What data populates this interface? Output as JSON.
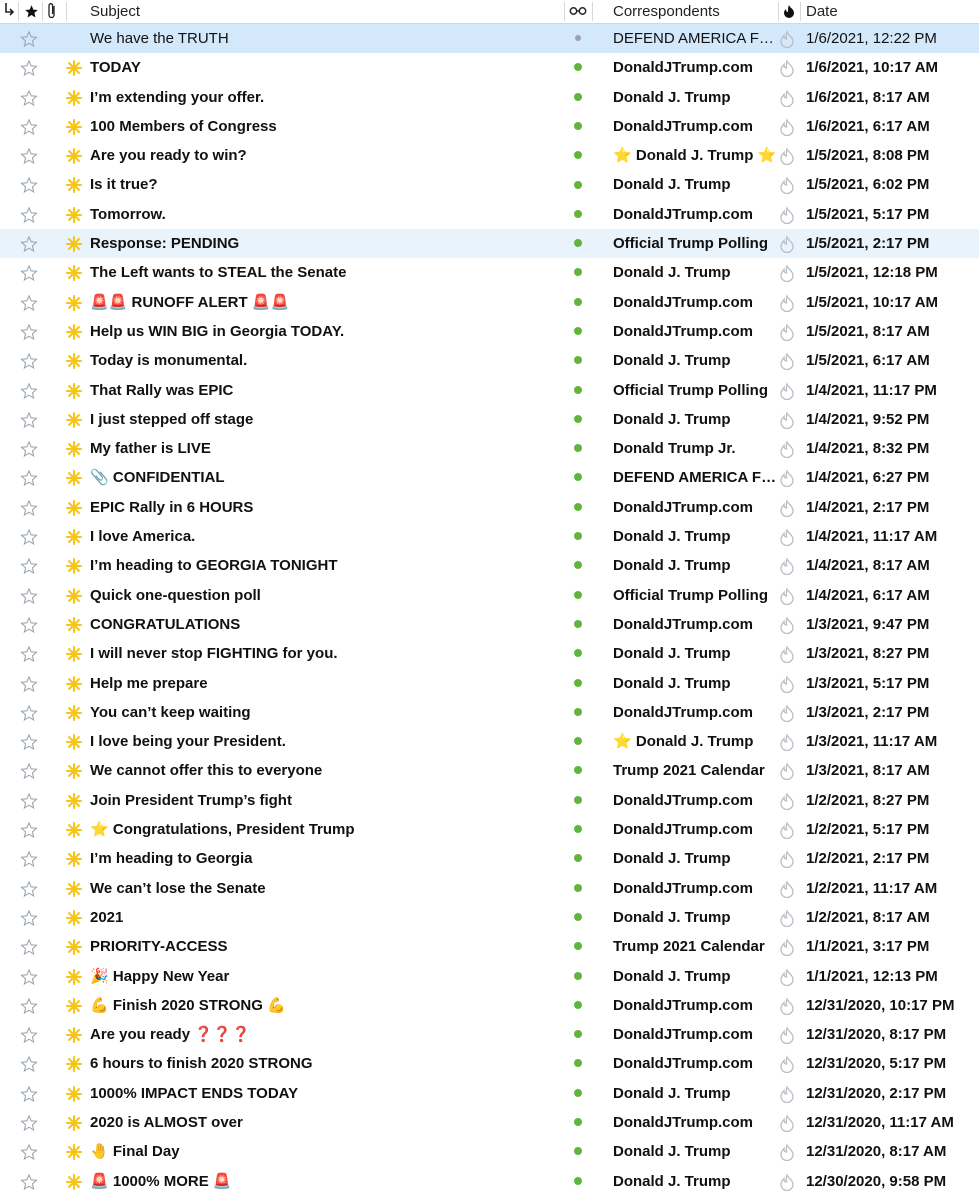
{
  "columns": {
    "thread_icon": "thread-icon",
    "star_icon": "star-icon",
    "attachment_icon": "paperclip-icon",
    "subject": "Subject",
    "read_status_icon": "glasses-icon",
    "correspondents": "Correspondents",
    "junk_icon": "flame-icon",
    "date": "Date"
  },
  "colors": {
    "selected_row": "#d4e8fb",
    "hover_row": "#e8f3fc",
    "unread_dot": "#62b33f",
    "new_icon": "#f5c518"
  },
  "messages": [
    {
      "subject": "We have the TRUTH",
      "correspondent": "DEFEND AMERICA FUND",
      "date": "1/6/2021, 12:22 PM",
      "state": "selected"
    },
    {
      "subject": "TODAY",
      "correspondent": "DonaldJTrump.com",
      "date": "1/6/2021, 10:17 AM"
    },
    {
      "subject": "I’m extending your offer.",
      "correspondent": "Donald J. Trump",
      "date": "1/6/2021, 8:17 AM"
    },
    {
      "subject": "100 Members of Congress",
      "correspondent": "DonaldJTrump.com",
      "date": "1/6/2021, 6:17 AM"
    },
    {
      "subject": "Are you ready to win?",
      "correspondent": "Donald J. Trump",
      "correspondent_prefix": "⭐",
      "correspondent_suffix": "⭐",
      "date": "1/5/2021, 8:08 PM"
    },
    {
      "subject": "Is it true?",
      "correspondent": "Donald J. Trump",
      "date": "1/5/2021, 6:02 PM"
    },
    {
      "subject": "Tomorrow.",
      "correspondent": "DonaldJTrump.com",
      "date": "1/5/2021, 5:17 PM"
    },
    {
      "subject": "Response: PENDING",
      "correspondent": "Official Trump Polling",
      "date": "1/5/2021, 2:17 PM",
      "state": "hover"
    },
    {
      "subject": "The Left wants to STEAL the Senate",
      "correspondent": "Donald J. Trump",
      "date": "1/5/2021, 12:18 PM"
    },
    {
      "subject": "RUNOFF ALERT",
      "subject_prefix": "🚨🚨",
      "subject_suffix": "🚨🚨",
      "correspondent": "DonaldJTrump.com",
      "date": "1/5/2021, 10:17 AM"
    },
    {
      "subject": "Help us WIN BIG in Georgia TODAY.",
      "correspondent": "DonaldJTrump.com",
      "date": "1/5/2021, 8:17 AM"
    },
    {
      "subject": "Today is monumental.",
      "correspondent": "Donald J. Trump",
      "date": "1/5/2021, 6:17 AM"
    },
    {
      "subject": "That Rally was EPIC",
      "correspondent": "Official Trump Polling",
      "date": "1/4/2021, 11:17 PM"
    },
    {
      "subject": "I just stepped off stage",
      "correspondent": "Donald J. Trump",
      "date": "1/4/2021, 9:52 PM"
    },
    {
      "subject": "My father is LIVE",
      "correspondent": "Donald Trump Jr.",
      "date": "1/4/2021, 8:32 PM"
    },
    {
      "subject": "CONFIDENTIAL",
      "subject_prefix": "📎",
      "correspondent": "DEFEND AMERICA FU…",
      "date": "1/4/2021, 6:27 PM"
    },
    {
      "subject": "EPIC Rally in 6 HOURS",
      "correspondent": "DonaldJTrump.com",
      "date": "1/4/2021, 2:17 PM"
    },
    {
      "subject": "I love America.",
      "correspondent": "Donald J. Trump",
      "date": "1/4/2021, 11:17 AM"
    },
    {
      "subject": "I’m heading to GEORGIA TONIGHT",
      "correspondent": "Donald J. Trump",
      "date": "1/4/2021, 8:17 AM"
    },
    {
      "subject": "Quick one-question poll",
      "correspondent": "Official Trump Polling",
      "date": "1/4/2021, 6:17 AM"
    },
    {
      "subject": "CONGRATULATIONS",
      "correspondent": "DonaldJTrump.com",
      "date": "1/3/2021, 9:47 PM"
    },
    {
      "subject": "I will never stop FIGHTING for you.",
      "correspondent": "Donald J. Trump",
      "date": "1/3/2021, 8:27 PM"
    },
    {
      "subject": "Help me prepare",
      "correspondent": "Donald J. Trump",
      "date": "1/3/2021, 5:17 PM"
    },
    {
      "subject": "You can’t keep waiting",
      "correspondent": "DonaldJTrump.com",
      "date": "1/3/2021, 2:17 PM"
    },
    {
      "subject": "I love being your President.",
      "correspondent": "Donald J. Trump",
      "correspondent_prefix": "⭐",
      "date": "1/3/2021, 11:17 AM"
    },
    {
      "subject": "We cannot offer this to everyone",
      "correspondent": "Trump 2021 Calendar",
      "date": "1/3/2021, 8:17 AM"
    },
    {
      "subject": "Join President Trump’s fight",
      "correspondent": "DonaldJTrump.com",
      "date": "1/2/2021, 8:27 PM"
    },
    {
      "subject": "Congratulations, President Trump",
      "subject_prefix": "⭐",
      "correspondent": "DonaldJTrump.com",
      "date": "1/2/2021, 5:17 PM"
    },
    {
      "subject": "I’m heading to Georgia",
      "correspondent": "Donald J. Trump",
      "date": "1/2/2021, 2:17 PM"
    },
    {
      "subject": "We can’t lose the Senate",
      "correspondent": "DonaldJTrump.com",
      "date": "1/2/2021, 11:17 AM"
    },
    {
      "subject": "2021",
      "correspondent": "Donald J. Trump",
      "date": "1/2/2021, 8:17 AM"
    },
    {
      "subject": "PRIORITY-ACCESS",
      "correspondent": "Trump 2021 Calendar",
      "date": "1/1/2021, 3:17 PM"
    },
    {
      "subject": "Happy New Year",
      "subject_prefix": "🎉",
      "correspondent": "Donald J. Trump",
      "date": "1/1/2021, 12:13 PM"
    },
    {
      "subject": "Finish 2020 STRONG",
      "subject_prefix": "💪",
      "subject_suffix": "💪",
      "correspondent": "DonaldJTrump.com",
      "date": "12/31/2020, 10:17 PM"
    },
    {
      "subject": "Are you ready",
      "subject_suffix": "❓❓❓",
      "correspondent": "DonaldJTrump.com",
      "date": "12/31/2020, 8:17 PM"
    },
    {
      "subject": "6 hours to finish 2020 STRONG",
      "correspondent": "DonaldJTrump.com",
      "date": "12/31/2020, 5:17 PM"
    },
    {
      "subject": "1000% IMPACT ENDS TODAY",
      "correspondent": "Donald J. Trump",
      "date": "12/31/2020, 2:17 PM"
    },
    {
      "subject": "2020 is ALMOST over",
      "correspondent": "DonaldJTrump.com",
      "date": "12/31/2020, 11:17 AM"
    },
    {
      "subject": "Final Day",
      "subject_prefix": "🤚",
      "correspondent": "Donald J. Trump",
      "date": "12/31/2020, 8:17 AM"
    },
    {
      "subject": "1000% MORE",
      "subject_prefix": "🚨",
      "subject_suffix": "🚨",
      "correspondent": "Donald J. Trump",
      "date": "12/30/2020, 9:58 PM"
    }
  ]
}
